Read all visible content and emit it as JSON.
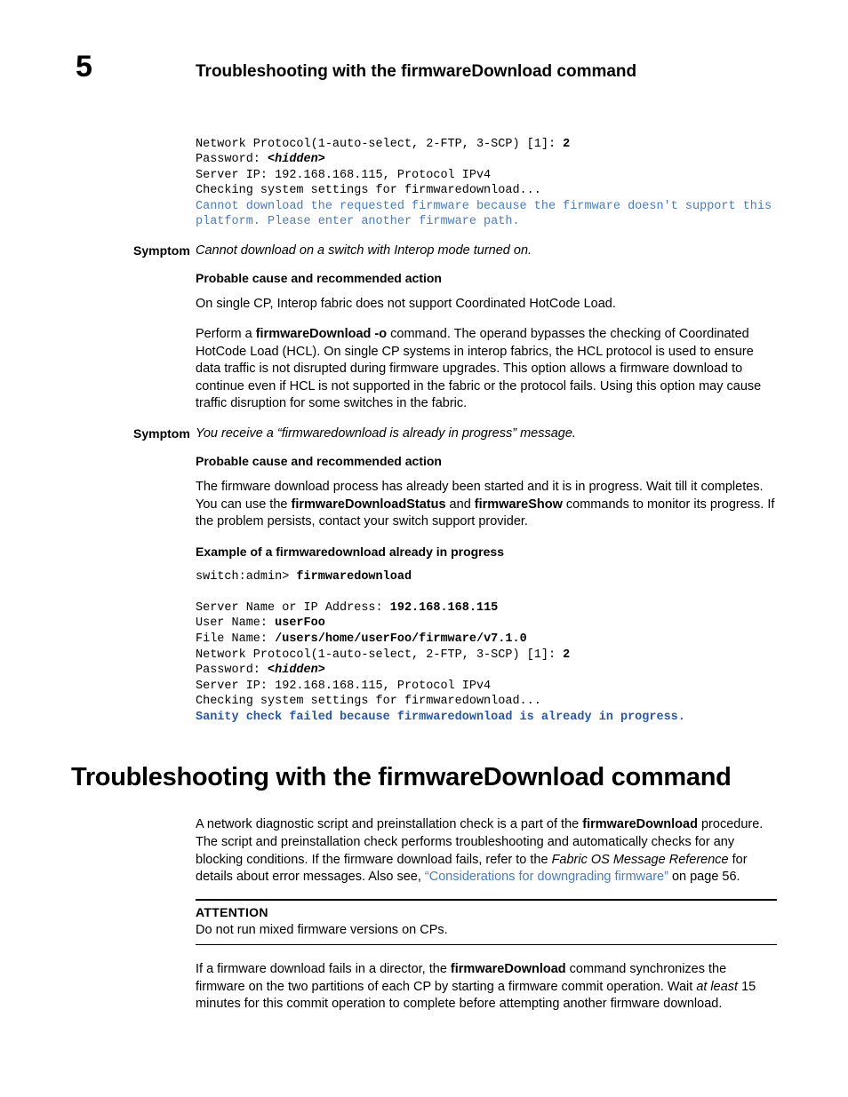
{
  "chapterNum": "5",
  "runningHead": "Troubleshooting with the firmwareDownload command",
  "code1": {
    "line1a": "Network Protocol(1-auto-select, 2-FTP, 3-SCP) [1]: ",
    "line1b": "2",
    "line2a": "Password: ",
    "line2b": "<hidden>",
    "line3": "Server IP: 192.168.168.115, Protocol IPv4",
    "line4": "Checking system settings for firmwaredownload...",
    "line5": "Cannot download the requested firmware because the firmware doesn't support this \nplatform. Please enter another firmware path."
  },
  "symptomA": {
    "label": "Symptom",
    "text": "Cannot download on a switch with Interop mode turned on."
  },
  "headA": "Probable cause and recommended action",
  "paraA1": "On single CP, Interop fabric does not support Coordinated HotCode Load.",
  "paraA2a": "Perform a ",
  "paraA2b": "firmwareDownload -o",
  "paraA2c": " command. The operand bypasses the checking of Coordinated HotCode Load (HCL). On single CP systems in interop fabrics, the HCL protocol is used to ensure data traffic is not disrupted during firmware upgrades. This option allows a firmware download to continue even if HCL is not supported in the fabric or the protocol fails. Using this option may cause traffic disruption for some switches in the fabric.",
  "symptomB": {
    "label": "Symptom",
    "text": "You receive a “firmwaredownload is already in progress” message."
  },
  "headB": "Probable cause and recommended action",
  "paraB1a": "The firmware download process has already been started and it is in progress. Wait till it completes. You can use the ",
  "paraB1b": "firmwareDownloadStatus",
  "paraB1c": " and ",
  "paraB1d": "firmwareShow",
  "paraB1e": " commands to monitor its progress. If the problem persists, contact your switch support provider.",
  "exHead": "Example  of a firmwaredownload already in progress",
  "code2": {
    "l1a": "switch:admin> ",
    "l1b": "firmwaredownload",
    "l2a": "Server Name or IP Address: ",
    "l2b": "192.168.168.115",
    "l3a": "User Name: ",
    "l3b": "userFoo",
    "l4a": "File Name: ",
    "l4b": "/users/home/userFoo/firmware/v7.1.0",
    "l5a": "Network Protocol(1-auto-select, 2-FTP, 3-SCP) [1]: ",
    "l5b": "2",
    "l6a": "Password: ",
    "l6b": "<hidden>",
    "l7": "Server IP: 192.168.168.115, Protocol IPv4",
    "l8": "Checking system settings for firmwaredownload...",
    "l9": "Sanity check failed because firmwaredownload is already in progress."
  },
  "h1": "Troubleshooting with the firmwareDownload command",
  "paraC1a": "A network diagnostic script and preinstallation check is a part of the ",
  "paraC1b": "firmwareDownload",
  "paraC1c": " procedure. The script and preinstallation check performs troubleshooting and automatically checks for any blocking conditions. If the firmware download fails, refer to the ",
  "paraC1d": "Fabric OS Message Reference",
  "paraC1e": " for details about error messages. Also see, ",
  "paraC1link": "“Considerations for downgrading firmware”",
  "paraC1f": " on page 56.",
  "attention": {
    "label": "ATTENTION",
    "text": "Do not run mixed firmware versions on CPs."
  },
  "paraD1a": "If a firmware download fails in a director, the ",
  "paraD1b": "firmwareDownload",
  "paraD1c": " command synchronizes the firmware on the two partitions of each CP by starting a firmware commit operation. Wait ",
  "paraD1d": "at least",
  "paraD1e": " 15 minutes for this commit operation to complete before attempting another firmware download."
}
